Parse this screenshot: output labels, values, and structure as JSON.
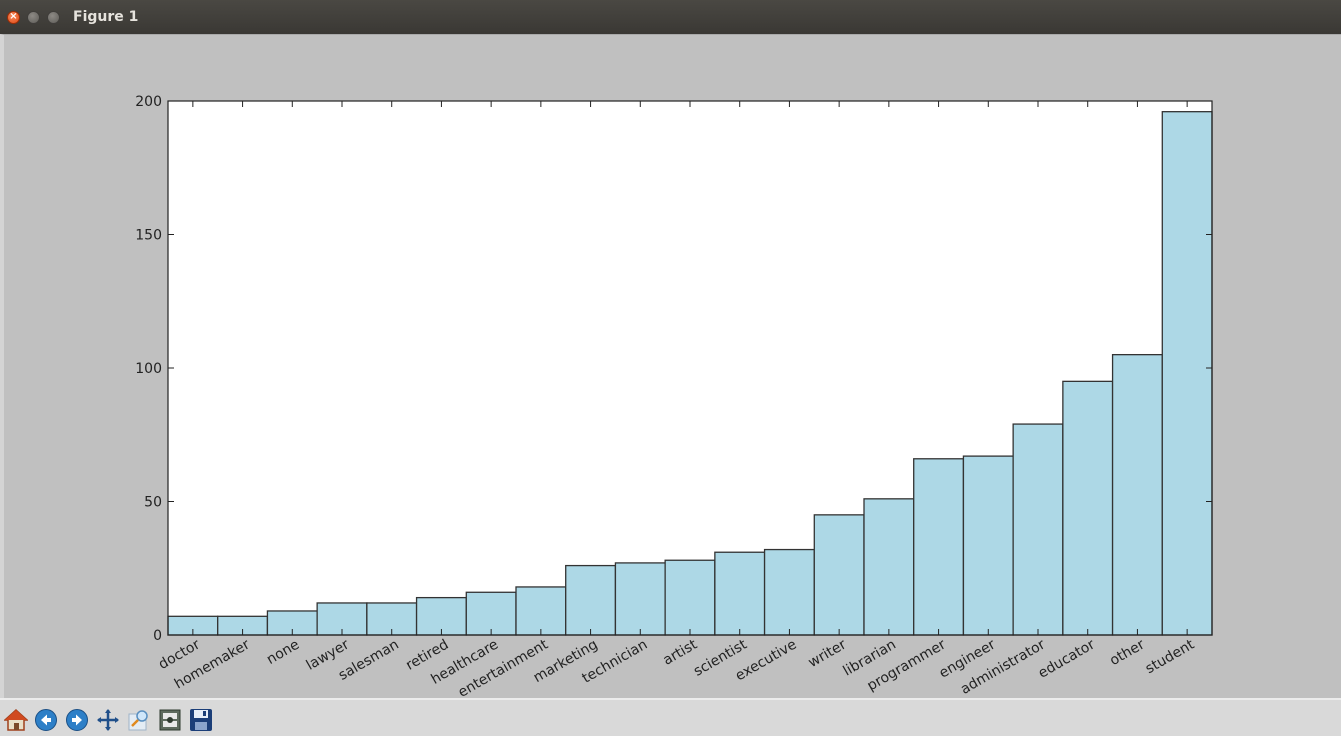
{
  "window": {
    "title": "Figure 1"
  },
  "toolbar": {
    "buttons": [
      {
        "icon": "home-icon"
      },
      {
        "icon": "back-icon"
      },
      {
        "icon": "forward-icon"
      },
      {
        "icon": "pan-icon"
      },
      {
        "icon": "zoom-icon"
      },
      {
        "icon": "configure-subplots-icon"
      },
      {
        "icon": "save-icon"
      }
    ]
  },
  "chart_data": {
    "type": "bar",
    "categories": [
      "doctor",
      "homemaker",
      "none",
      "lawyer",
      "salesman",
      "retired",
      "healthcare",
      "entertainment",
      "marketing",
      "technician",
      "artist",
      "scientist",
      "executive",
      "writer",
      "librarian",
      "programmer",
      "engineer",
      "administrator",
      "educator",
      "other",
      "student"
    ],
    "values": [
      7,
      7,
      9,
      12,
      12,
      14,
      16,
      18,
      26,
      27,
      28,
      31,
      32,
      45,
      51,
      66,
      67,
      79,
      95,
      105,
      196
    ],
    "ylim": [
      0,
      200
    ],
    "yticks": [
      0,
      50,
      100,
      150,
      200
    ],
    "bar_color": "#add8e6",
    "edge_color": "#333333",
    "grid": false,
    "title": "",
    "xlabel": "",
    "ylabel": ""
  }
}
